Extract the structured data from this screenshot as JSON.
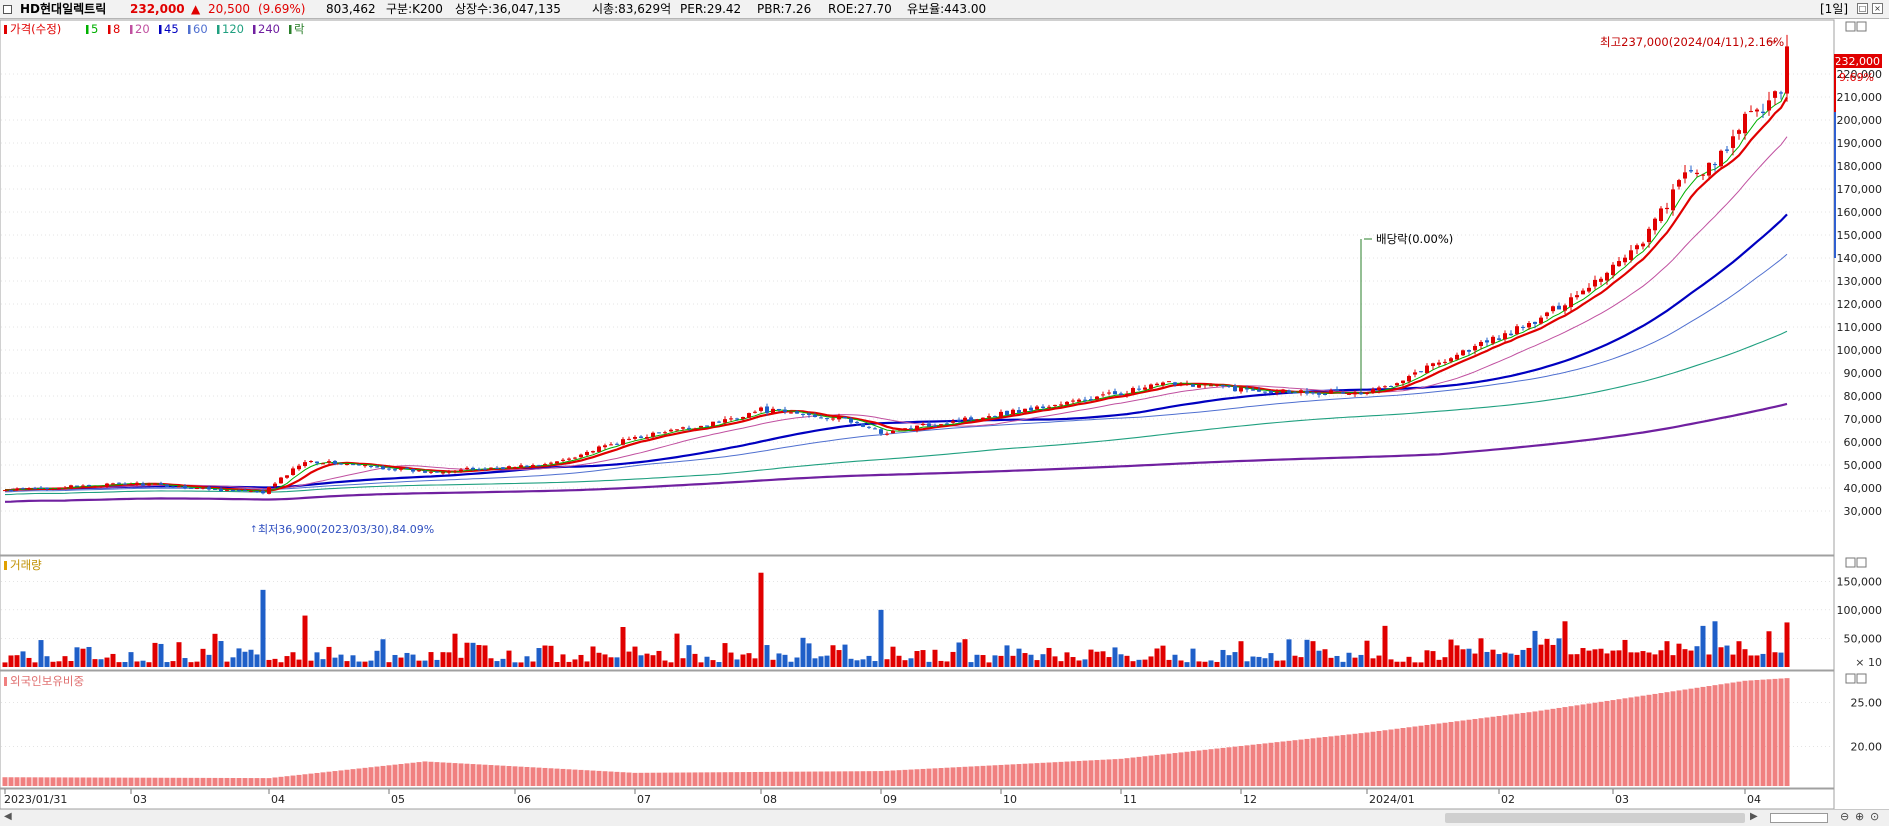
{
  "header": {
    "stock_name": "HD현대일렉트릭",
    "price": "232,000",
    "change_arrow": "▲",
    "change": "20,500",
    "change_pct": "(9.69%)",
    "volume": "803,462",
    "market": "구분:K200",
    "shares": "상장수:36,047,135",
    "market_cap": "시총:83,629억",
    "per": "PER:29.42",
    "pbr": "PBR:7.26",
    "roe": "ROE:27.70",
    "retention": "유보율:443.00",
    "period": "[1일]"
  },
  "legend": {
    "price_label": "가격(수정)",
    "ma": [
      {
        "label": "5",
        "color": "#00b000"
      },
      {
        "label": "8",
        "color": "#e00000"
      },
      {
        "label": "20",
        "color": "#c050a0"
      },
      {
        "label": "45",
        "color": "#0000c0"
      },
      {
        "label": "60",
        "color": "#5070d0"
      },
      {
        "label": "120",
        "color": "#20a080"
      },
      {
        "label": "240",
        "color": "#7020a0"
      }
    ],
    "ex_label": "락"
  },
  "annotations": {
    "high": "최고237,000(2024/04/11),2.16%",
    "low": "최저36,900(2023/03/30),84.09%",
    "dividend": "배당락(0.00%)",
    "last_price": "232,000",
    "last_pct": "9.69%"
  },
  "volume_panel": {
    "title": "거래량",
    "unit": "× 10"
  },
  "foreign_panel": {
    "title": "외국인보유비중"
  },
  "colors": {
    "up": "#e00000",
    "down": "#1f5fc8",
    "foreign_bar": "#f08080",
    "grid": "#c8c8c8",
    "panel_border": "#a0a0a0"
  },
  "chart_data": [
    {
      "type": "candlestick",
      "title": "HD현대일렉트릭",
      "y_axis_ticks": [
        30000,
        40000,
        50000,
        60000,
        70000,
        80000,
        90000,
        100000,
        110000,
        120000,
        130000,
        140000,
        150000,
        160000,
        170000,
        180000,
        190000,
        200000,
        210000,
        220000,
        232000
      ],
      "y_tick_labels": [
        "30,000",
        "40,000",
        "50,000",
        "60,000",
        "70,000",
        "80,000",
        "90,000",
        "100,000",
        "110,000",
        "120,000",
        "130,000",
        "140,000",
        "150,000",
        "160,000",
        "170,000",
        "180,000",
        "190,000",
        "200,000",
        "210,000",
        "220,000",
        "232,000"
      ],
      "ylim": [
        25000,
        245000
      ],
      "x_labels": [
        "2023/01/31",
        "03",
        "04",
        "05",
        "06",
        "07",
        "08",
        "09",
        "10",
        "11",
        "12",
        "2024/01",
        "02",
        "03",
        "04"
      ],
      "x_label_index": [
        0,
        21,
        44,
        64,
        85,
        105,
        126,
        146,
        166,
        186,
        206,
        227,
        249,
        268,
        290
      ],
      "anchors_index": [
        0,
        21,
        43,
        50,
        70,
        90,
        105,
        118,
        126,
        140,
        146,
        160,
        175,
        195,
        206,
        227,
        240,
        255,
        265,
        273,
        280,
        285,
        290,
        296,
        297
      ],
      "anchors_close": [
        39000,
        42000,
        38000,
        52000,
        47000,
        50000,
        62000,
        68000,
        74000,
        70000,
        64000,
        70000,
        76000,
        86000,
        83000,
        81000,
        96000,
        112000,
        130000,
        148000,
        176000,
        180000,
        200000,
        211500,
        232000
      ],
      "high_point": 237000,
      "low_point": 36900,
      "last_close": 232000,
      "last_change_pct": 9.69
    },
    {
      "type": "bar",
      "title": "거래량",
      "y_tick_labels": [
        "50,000",
        "100,000",
        "150,000"
      ],
      "y_axis_ticks": [
        50000,
        100000,
        150000
      ],
      "ylim": [
        0,
        175000
      ],
      "unit_multiplier": 10
    },
    {
      "type": "bar",
      "title": "외국인보유비중",
      "y_tick_labels": [
        "20.00",
        "25.00"
      ],
      "y_axis_ticks": [
        20,
        25
      ],
      "ylim": [
        15.5,
        28.5
      ],
      "x_anchor_index": [
        0,
        44,
        70,
        105,
        146,
        186,
        227,
        255,
        273,
        290,
        297
      ],
      "values_anchor": [
        16.5,
        16.4,
        18.3,
        17.0,
        17.2,
        18.6,
        21.6,
        24.0,
        25.8,
        27.5,
        27.8
      ]
    }
  ]
}
